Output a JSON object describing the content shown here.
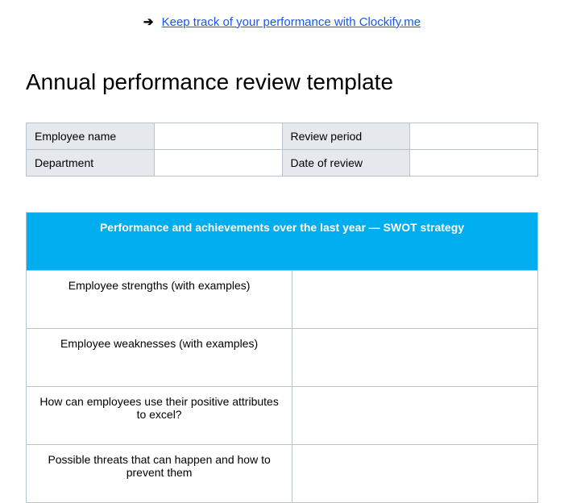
{
  "topLink": {
    "arrow": "➔",
    "text": "Keep track of your performance with Clockify.me"
  },
  "title": "Annual performance review template",
  "infoTable": {
    "rows": [
      {
        "label1": "Employee name",
        "value1": "",
        "label2": "Review period",
        "value2": ""
      },
      {
        "label1": "Department",
        "value1": "",
        "label2": "Date of review",
        "value2": ""
      }
    ]
  },
  "swot": {
    "header": "Performance and achievements over the last year — SWOT strategy",
    "rows": [
      {
        "label": "Employee strengths (with examples)",
        "value": ""
      },
      {
        "label": "Employee weaknesses (with examples)",
        "value": ""
      },
      {
        "label": "How can employees use their positive attributes to excel?",
        "value": ""
      },
      {
        "label": "Possible threats that can happen and how to prevent them",
        "value": ""
      }
    ]
  }
}
